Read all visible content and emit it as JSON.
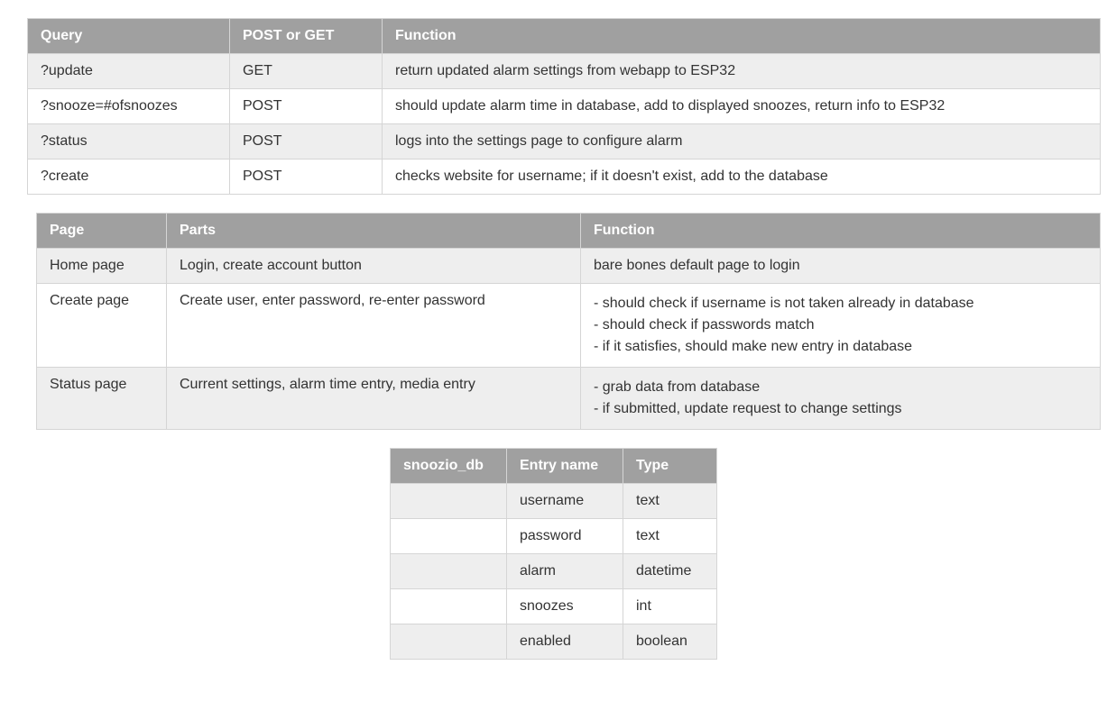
{
  "table1": {
    "headers": [
      "Query",
      "POST or GET",
      "Function"
    ],
    "rows": [
      {
        "cells": [
          "?update",
          "GET",
          "return updated alarm settings from webapp to ESP32"
        ]
      },
      {
        "cells": [
          "?snooze=#ofsnoozes",
          "POST",
          "should update alarm time in database, add to displayed snoozes, return info to ESP32"
        ]
      },
      {
        "cells": [
          "?status",
          "POST",
          "logs into the settings page to configure alarm"
        ]
      },
      {
        "cells": [
          "?create",
          "POST",
          "checks website for username; if it doesn't exist, add to the database"
        ]
      }
    ]
  },
  "table2": {
    "headers": [
      "Page",
      "Parts",
      "Function"
    ],
    "rows": [
      {
        "cells": [
          "Home page",
          "Login, create account button",
          "bare bones default page to login"
        ]
      },
      {
        "cells": [
          "Create page",
          "Create user, enter password, re-enter password",
          ""
        ],
        "multiline": [
          "- should check if username is not taken already in database",
          "- should check if passwords match",
          "- if it satisfies, should make new entry in database"
        ]
      },
      {
        "cells": [
          "Status page",
          "Current settings, alarm time entry, media entry",
          ""
        ],
        "multiline": [
          "- grab data from database",
          "- if submitted, update request to change settings"
        ]
      }
    ]
  },
  "table3": {
    "headers": [
      "snoozio_db",
      "Entry name",
      "Type"
    ],
    "rows": [
      {
        "cells": [
          "",
          "username",
          "text"
        ]
      },
      {
        "cells": [
          "",
          "password",
          "text"
        ]
      },
      {
        "cells": [
          "",
          "alarm",
          "datetime"
        ]
      },
      {
        "cells": [
          "",
          "snoozes",
          "int"
        ]
      },
      {
        "cells": [
          "",
          "enabled",
          "boolean"
        ]
      }
    ]
  }
}
